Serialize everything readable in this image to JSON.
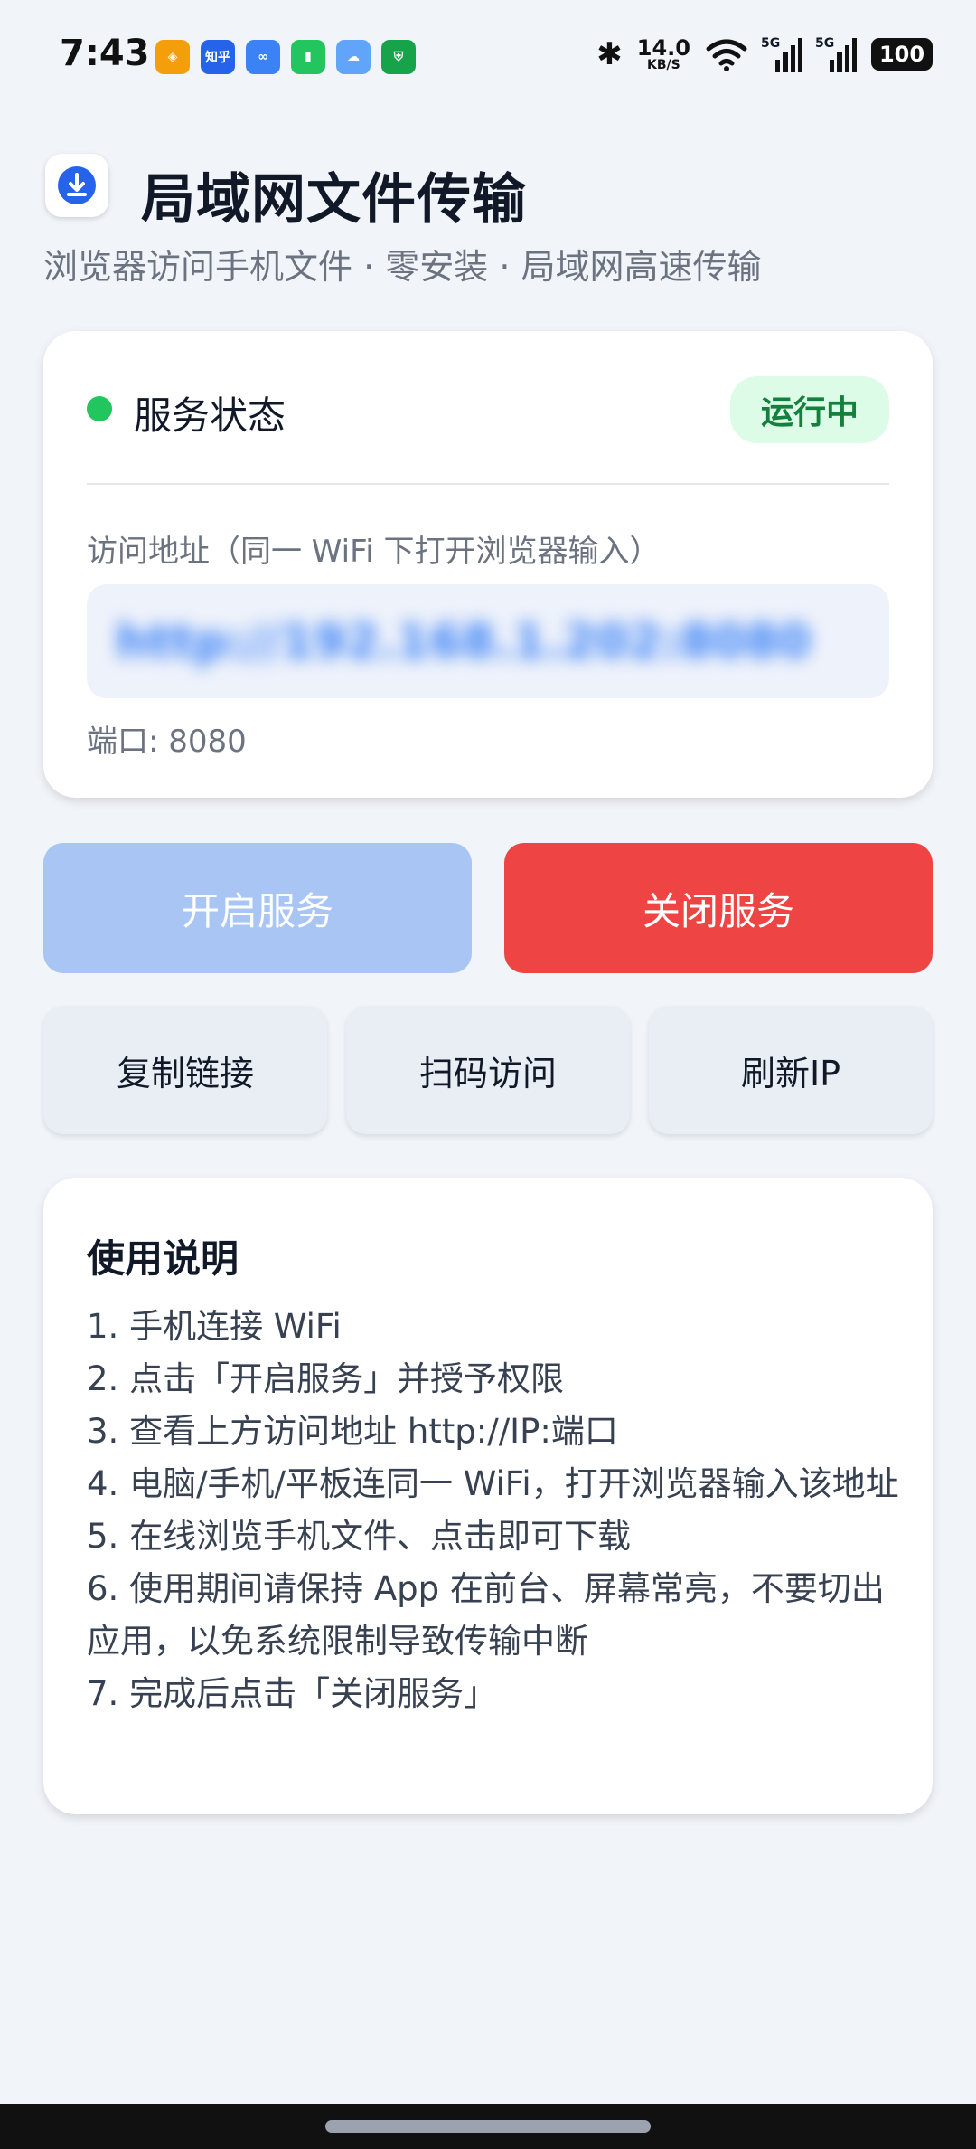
{
  "status_bar": {
    "time": "7:43",
    "notification_icons": [
      {
        "name": "app-orange-icon",
        "text": "◈",
        "color": "#f59e0b"
      },
      {
        "name": "zhihu-icon",
        "text": "知乎",
        "color": "#2563eb"
      },
      {
        "name": "link-icon",
        "text": "∞",
        "color": "#3b82f6"
      },
      {
        "name": "battery-app-icon",
        "text": "▮",
        "color": "#22c55e"
      },
      {
        "name": "weather-icon",
        "text": "☁",
        "color": "#60a5fa"
      },
      {
        "name": "shield-icon",
        "text": "⛨",
        "color": "#16a34a"
      }
    ],
    "net_speed_value": "14.0",
    "net_speed_unit": "KB/S",
    "signal1_label": "5G",
    "signal2_label": "5G",
    "battery_level": "100"
  },
  "header": {
    "title": "局域网文件传输",
    "subtitle": "浏览器访问手机文件 · 零安装 · 局域网高速传输"
  },
  "status_card": {
    "label": "服务状态",
    "badge": "运行中",
    "address_caption": "访问地址（同一 WiFi 下打开浏览器输入）",
    "address": "http://192.168.1.202:8080",
    "port": "端口: 8080"
  },
  "buttons": {
    "start": "开启服务",
    "stop": "关闭服务",
    "copy": "复制链接",
    "scan": "扫码访问",
    "refresh": "刷新IP"
  },
  "instructions": {
    "title": "使用说明",
    "items": [
      "1. 手机连接 WiFi",
      "2. 点击「开启服务」并授予权限",
      "3. 查看上方访问地址 http://IP:端口",
      "4. 电脑/手机/平板连同一 WiFi，打开浏览器输入该地址",
      "5. 在线浏览手机文件、点击即可下载",
      "6. 使用期间请保持 App 在前台、屏幕常亮，不要切出应用，以免系统限制导致传输中断",
      "7. 完成后点击「关闭服务」"
    ]
  },
  "colors": {
    "accent": "#3b82f6",
    "running_green": "#22c55e",
    "stop_red": "#ef4444",
    "start_disabled": "#a9c5f3"
  }
}
